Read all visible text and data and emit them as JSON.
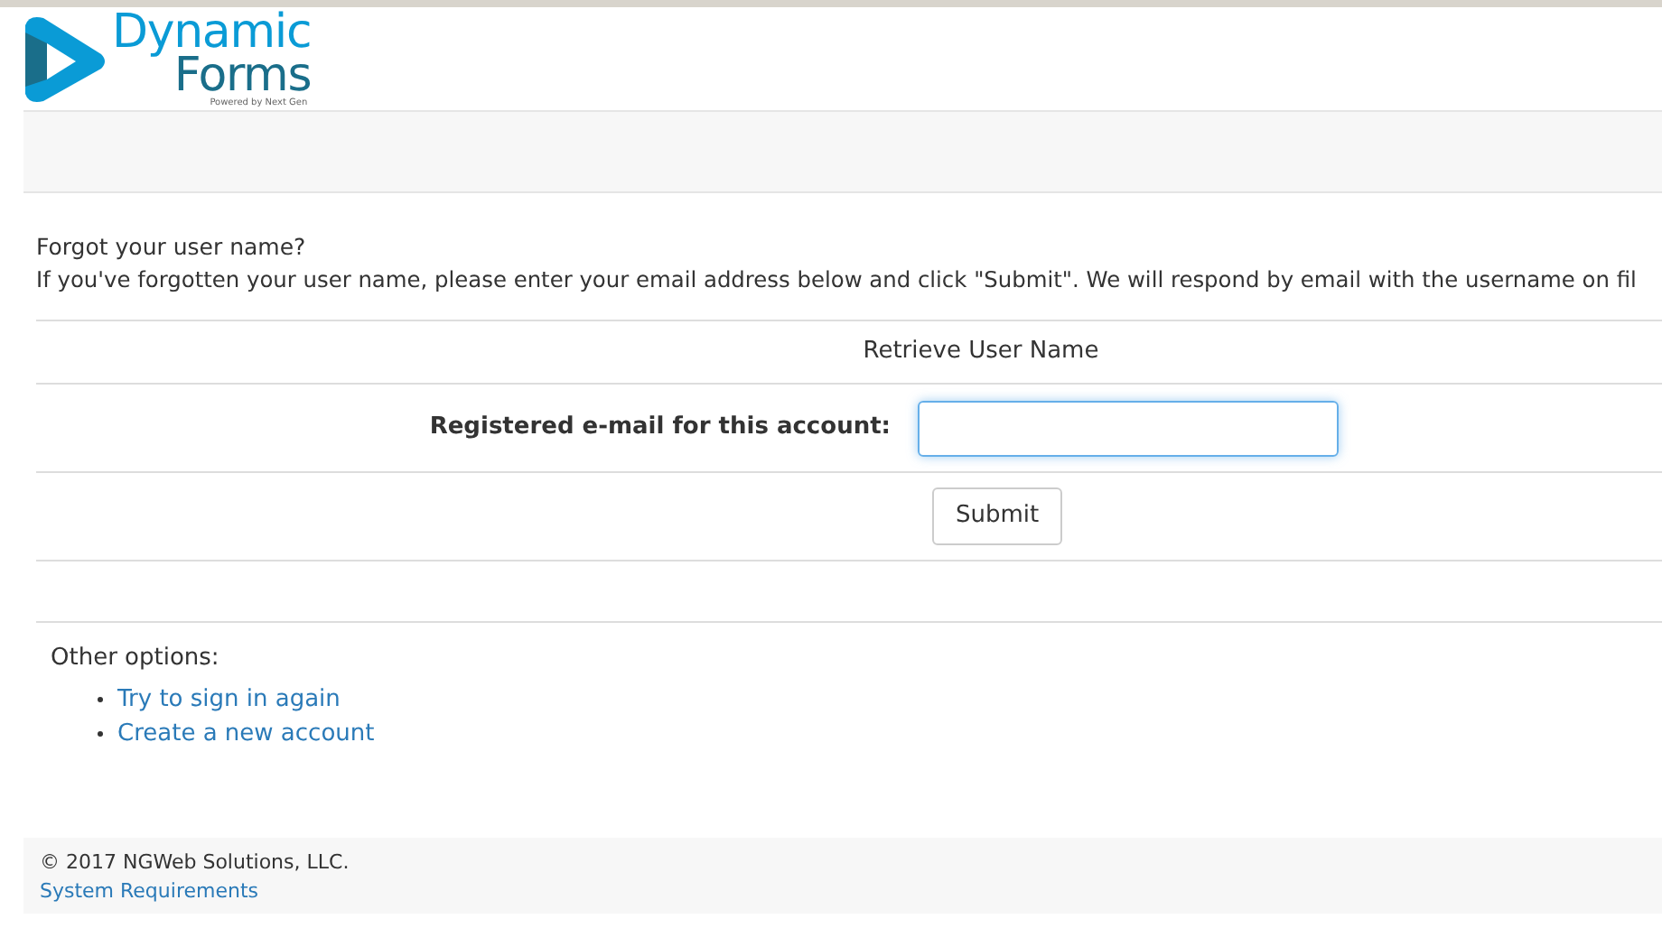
{
  "logo": {
    "line_1": "Dynamic",
    "line_2": "Forms",
    "tagline": "Powered by Next Gen"
  },
  "intro": {
    "title": "Forgot your user name?",
    "text": "If you've forgotten your user name, please enter your email address below and click \"Submit\". We will respond by email with the username on fil"
  },
  "form": {
    "heading": "Retrieve User Name",
    "field_label": "Registered e-mail for this account:",
    "submit": "Submit"
  },
  "other_options": {
    "title": "Other options:",
    "links": [
      "Try to sign in again",
      "Create a new account"
    ]
  },
  "footer": {
    "copyright": "© 2017 NGWeb Solutions, LLC.",
    "link": "System Requirements"
  }
}
